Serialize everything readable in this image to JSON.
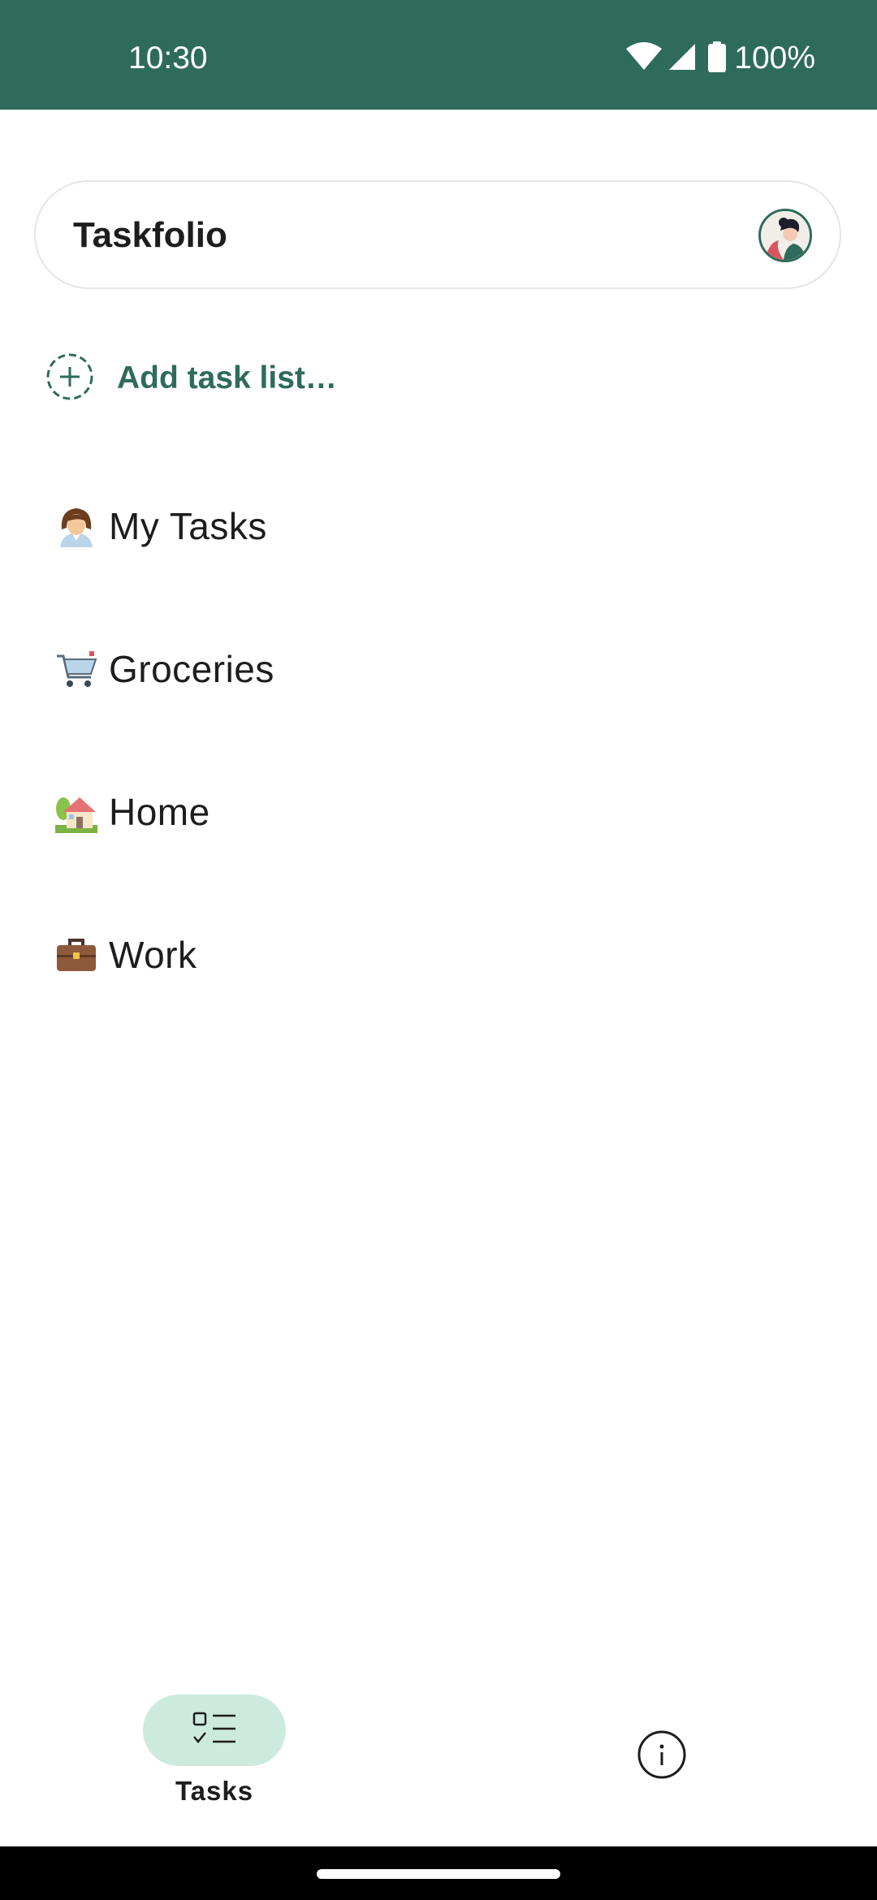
{
  "status_bar": {
    "time": "10:30",
    "battery": "100%",
    "icons": [
      "wifi-icon",
      "signal-icon",
      "battery-icon"
    ],
    "background": "#2e6b5a"
  },
  "header": {
    "title": "Taskfolio",
    "avatar_icon": "avatar-icon"
  },
  "add_list": {
    "icon": "add-circle-icon",
    "label": "Add task list…"
  },
  "task_lists": [
    {
      "emoji": "👩‍💼",
      "icon": "office-worker-icon",
      "label": "My Tasks"
    },
    {
      "emoji": "🛒",
      "icon": "shopping-cart-icon",
      "label": "Groceries"
    },
    {
      "emoji": "🏡",
      "icon": "house-icon",
      "label": "Home"
    },
    {
      "emoji": "💼",
      "icon": "briefcase-icon",
      "label": "Work"
    }
  ],
  "bottom_nav": {
    "tasks_label": "Tasks",
    "tasks_icon": "checklist-icon",
    "info_icon": "info-icon",
    "active_color": "#cdeadf"
  },
  "colors": {
    "accent": "#2e6b5a",
    "text": "#1d1d1d"
  }
}
